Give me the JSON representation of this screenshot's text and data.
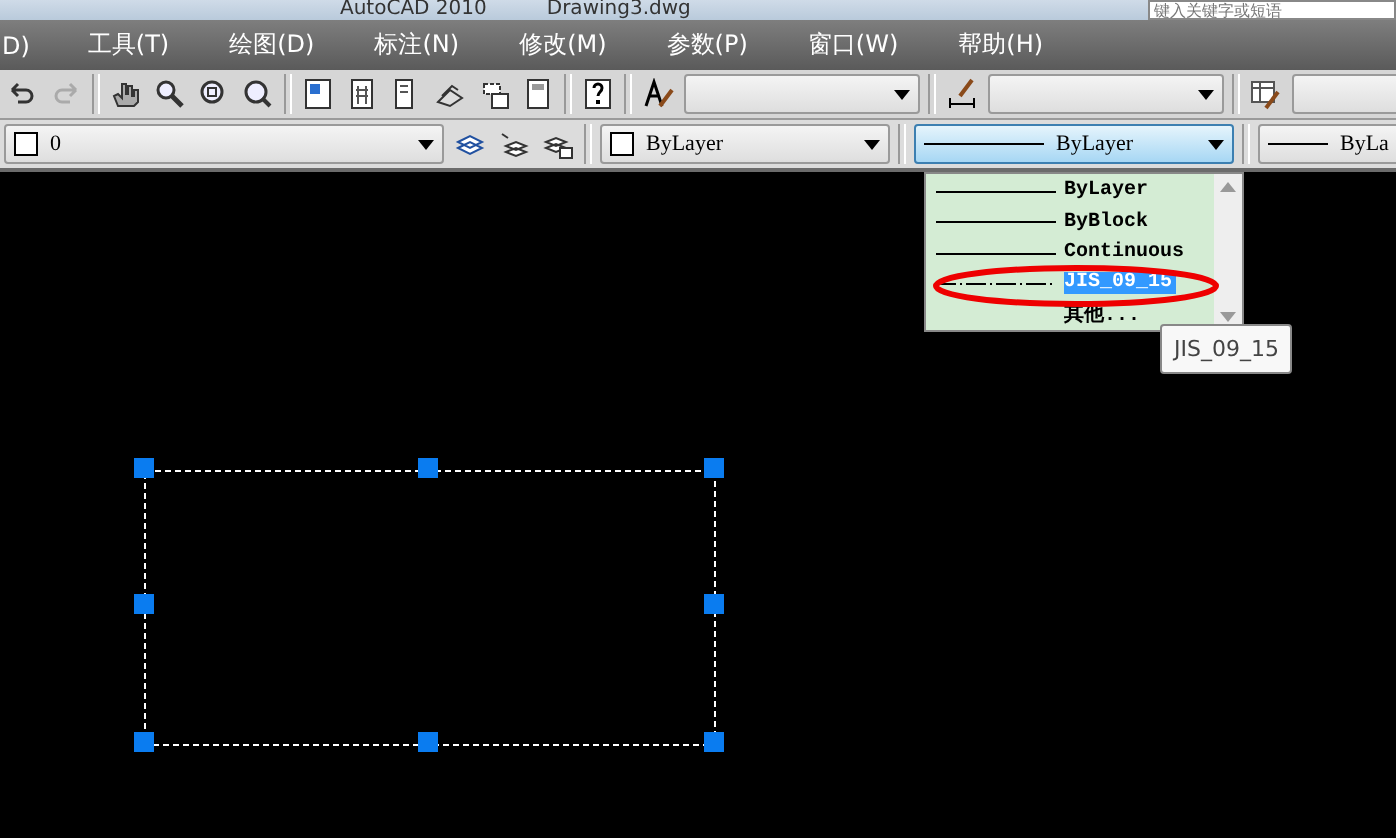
{
  "title_bar": {
    "app": "AutoCAD 2010",
    "file": "Drawing3.dwg",
    "search": {
      "placeholder": "键入关键字或短语"
    }
  },
  "menu": [
    "D)",
    "工具(T)",
    "绘图(D)",
    "标注(N)",
    "修改(M)",
    "参数(P)",
    "窗口(W)",
    "帮助(H)"
  ],
  "properties_bar": {
    "layer": "0",
    "color_setting": "ByLayer",
    "linetype": {
      "value": "ByLayer",
      "expanded": true
    },
    "lineweight": "ByLa"
  },
  "linetype_list": [
    {
      "label": "ByLayer",
      "kind": "solid",
      "selected": false
    },
    {
      "label": "ByBlock",
      "kind": "solid",
      "selected": false
    },
    {
      "label": "Continuous",
      "kind": "solid",
      "selected": false
    },
    {
      "label": "JIS_09_15",
      "kind": "dashed",
      "selected": true
    },
    {
      "label": "其他...",
      "kind": "none",
      "selected": false
    }
  ],
  "tooltip": "JIS_09_15"
}
